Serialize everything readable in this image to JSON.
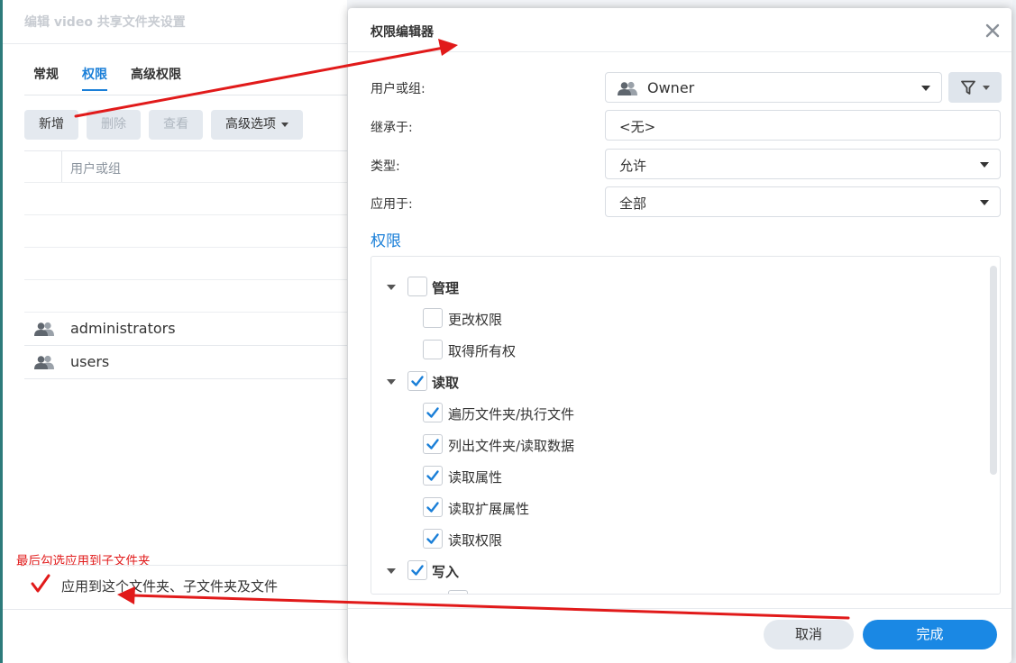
{
  "background_window": {
    "title": "编辑 video 共享文件夹设置",
    "tabs": [
      {
        "label": "常规",
        "active": false
      },
      {
        "label": "权限",
        "active": true
      },
      {
        "label": "高级权限",
        "active": false
      }
    ],
    "toolbar": {
      "add": "新增",
      "delete": "删除",
      "view": "查看",
      "advanced": "高级选项"
    },
    "list_header": "用户或组",
    "rows": [
      {
        "icon": "user-group-icon",
        "name": "administrators"
      },
      {
        "icon": "user-group-icon",
        "name": "users"
      }
    ],
    "apply_to_subfolders": {
      "label": "应用到这个文件夹、子文件夹及文件",
      "checked": true
    }
  },
  "annotation": {
    "note": "最后勾选应用到子文件夹",
    "color": "#e11a1a"
  },
  "dialog": {
    "title": "权限编辑器",
    "fields": {
      "user_or_group": {
        "label": "用户或组:",
        "value": "Owner"
      },
      "inherit_from": {
        "label": "继承于:",
        "value": "<无>"
      },
      "type": {
        "label": "类型:",
        "value": "允许"
      },
      "apply_to": {
        "label": "应用于:",
        "value": "全部"
      }
    },
    "permissions_title": "权限",
    "permissions": [
      {
        "label": "管理",
        "group": true,
        "checked": false,
        "children": [
          {
            "label": "更改权限",
            "checked": false
          },
          {
            "label": "取得所有权",
            "checked": false
          }
        ]
      },
      {
        "label": "读取",
        "group": true,
        "checked": true,
        "children": [
          {
            "label": "遍历文件夹/执行文件",
            "checked": true
          },
          {
            "label": "列出文件夹/读取数据",
            "checked": true
          },
          {
            "label": "读取属性",
            "checked": true
          },
          {
            "label": "读取扩展属性",
            "checked": true
          },
          {
            "label": "读取权限",
            "checked": true
          }
        ]
      },
      {
        "label": "写入",
        "group": true,
        "checked": true
      }
    ],
    "buttons": {
      "cancel": "取消",
      "ok": "完成"
    }
  },
  "colors": {
    "accent": "#1a7fd8",
    "primary_button": "#1a88e4",
    "annotation": "#e11a1a"
  }
}
